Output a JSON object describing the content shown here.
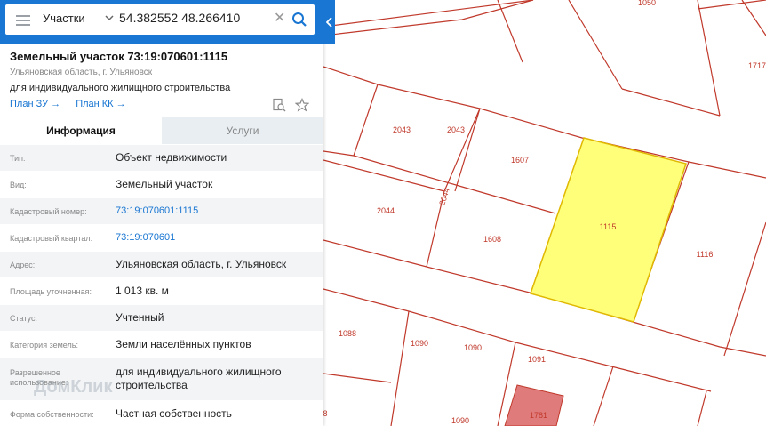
{
  "search": {
    "layer": "Участки",
    "coords": "54.382552 48.266410"
  },
  "parcel": {
    "title": "Земельный участок 73:19:070601:1115",
    "address_short": "Ульяновская область, г. Ульяновск",
    "purpose": "для индивидуального жилищного строительства",
    "link_plan_zu": "План ЗУ →",
    "link_plan_kk": "План КК →"
  },
  "tabs": {
    "info": "Информация",
    "services": "Услуги"
  },
  "rows": [
    {
      "label": "Тип:",
      "value": "Объект недвижимости"
    },
    {
      "label": "Вид:",
      "value": "Земельный участок"
    },
    {
      "label": "Кадастровый номер:",
      "value": "73:19:070601:1115"
    },
    {
      "label": "Кадастровый квартал:",
      "value": "73:19:070601"
    },
    {
      "label": "Адрес:",
      "value": "Ульяновская область, г. Ульяновск"
    },
    {
      "label": "Площадь уточненная:",
      "value": "1 013 кв. м"
    },
    {
      "label": "Статус:",
      "value": "Учтенный"
    },
    {
      "label": "Категория земель:",
      "value": "Земли населённых пунктов"
    },
    {
      "label": "Разрешенное использование:",
      "value": "для индивидуального жилищного строительства"
    },
    {
      "label": "Форма собственности:",
      "value": "Частная собственность"
    }
  ],
  "watermark": "ДомКлик",
  "map": {
    "parcel_labels": [
      "1050",
      "1717",
      "2043",
      "2043",
      "1607",
      "2044",
      "2044",
      "1608",
      "1115",
      "1116",
      "1088",
      "1090",
      "1090",
      "1091",
      "1090",
      "1781",
      "8"
    ],
    "colors": {
      "boundary": "#c0392b",
      "selected_fill": "#ffff7a",
      "selected_stroke": "#e0b800",
      "building_fill": "#e07b7b",
      "accent": "#1976d2"
    }
  }
}
